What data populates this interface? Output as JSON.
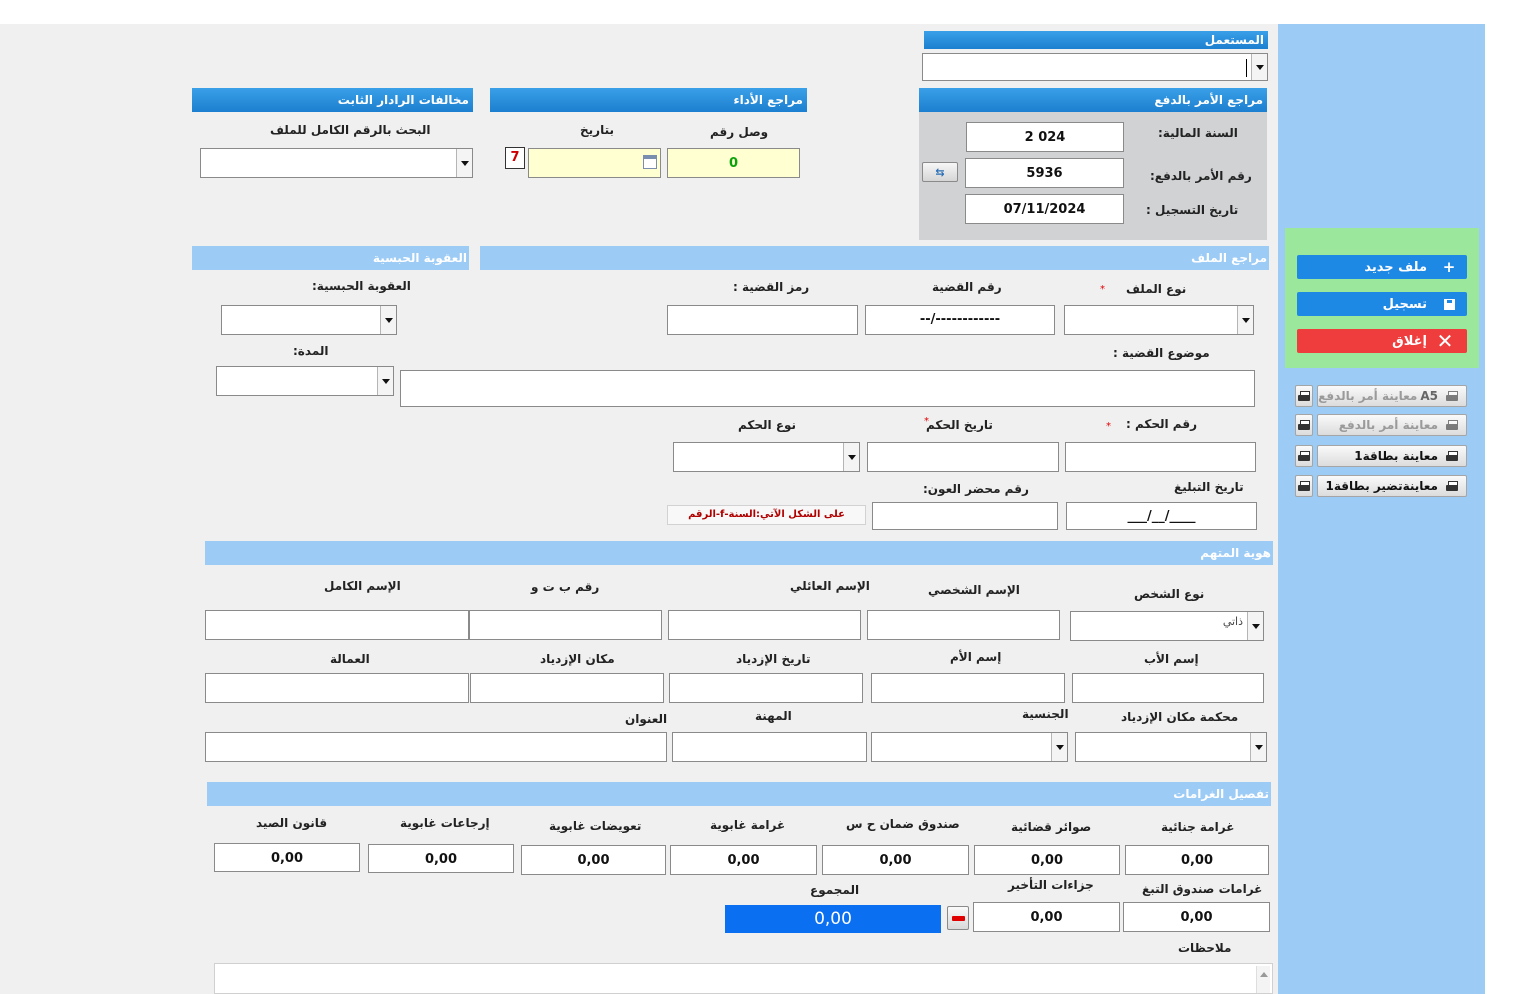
{
  "user": {
    "title": "المستعمل",
    "value": ""
  },
  "payment_order": {
    "title": "مراجع الأمر بالدفع",
    "fiscal_year_label": "السنة المالية:",
    "fiscal_year": "2 024",
    "order_number_label": "رقم الأمر بالدفع:",
    "order_number": "5936",
    "registration_date_label": "تاريخ التسجيل :",
    "registration_date": "07/11/2024"
  },
  "payment_refs": {
    "title": "مراجع الأداء",
    "receipt_label": "وصل رقم",
    "receipt_value": "0",
    "date_label": "بتاريخ",
    "date_value": ""
  },
  "radar": {
    "title": "مخالفات الرادار الثابت",
    "search_label": "البحث بالرقم الكامل للملف",
    "search_value": ""
  },
  "file_refs": {
    "title": "مراجع الملف",
    "file_type_label": "نوع الملف",
    "case_number_label": "رقم القضية",
    "case_number_value": "--/------------",
    "case_code_label": "رمز القضية :",
    "case_subject_label": "موضوع القضية :",
    "judgment_number_label": "رقم الحكم :",
    "judgment_date_label": "تاريخ الحكم",
    "judgment_type_label": "نوع الحكم",
    "notification_date_label": "تاريخ التبليغ",
    "notification_date_value": "___/__/____",
    "bailiff_report_label": "رقم محضر العون:",
    "format_hint": "على الشكل الآتي:السنة-f-الرقم"
  },
  "prison": {
    "title": "العقوبة الحبسية",
    "penalty_label": "العقوبة الحبسية:",
    "duration_label": "المدة:"
  },
  "accused": {
    "title": "هوية المتهم",
    "person_type_label": "نوع الشخص",
    "person_type_value": "ذاتي",
    "first_name_label": "الإسم الشخصي",
    "family_name_label": "الإسم العائلي",
    "id_number_label": "رقم ب ت و",
    "full_name_label": "الإسم الكامل",
    "father_label": "إسم الأب",
    "mother_label": "إسم الأم",
    "birth_date_label": "تاريخ الإزدياد",
    "birth_place_label": "مكان الإزدياد",
    "province_label": "العمالة",
    "birth_court_label": "محكمة مكان الإزدياد",
    "nationality_label": "الجنسية",
    "profession_label": "المهنة",
    "address_label": "العنوان"
  },
  "fines": {
    "title": "تفصيل الغرامات",
    "criminal_fine_label": "غرامة جنائية",
    "criminal_fine": "0,00",
    "judicial_costs_label": "صوائر قضائية",
    "judicial_costs": "0,00",
    "guarantee_fund_label": "صندوق ضمان ح س",
    "guarantee_fund": "0,00",
    "forest_fine_label": "غرامة غابوية",
    "forest_fine": "0,00",
    "forest_comp_label": "تعويضات غابوية",
    "forest_comp": "0,00",
    "forest_returns_label": "إرجاعات غابوية",
    "forest_returns": "0,00",
    "hunting_law_label": "قانون الصيد",
    "hunting_law": "0,00",
    "tobacco_fund_label": "غرامات صندوق التبغ",
    "tobacco_fund": "0,00",
    "delay_penalties_label": "جزاءات التأخير",
    "delay_penalties": "0,00",
    "total_label": "المجموع",
    "total": "0,00",
    "notes_label": "ملاحظات"
  },
  "actions": {
    "new_file": "ملف جديد",
    "save": "تسجيل",
    "close": "إغلاق"
  },
  "prints": {
    "preview_a5": "معاينة أمر بالدفع",
    "preview_a5_tag": "A5",
    "preview_order": "معاينة أمر بالدفع",
    "preview_card": "معاينة بطاقة1",
    "preview_card_prep": "معاينةتضير بطاقة1"
  },
  "colors": {
    "header_blue": "#1c7fd0",
    "light_blue": "#9ccbf5",
    "green_panel": "#9be79b",
    "close_red": "#ef3c3c",
    "total_blue": "#0b6ff2"
  }
}
